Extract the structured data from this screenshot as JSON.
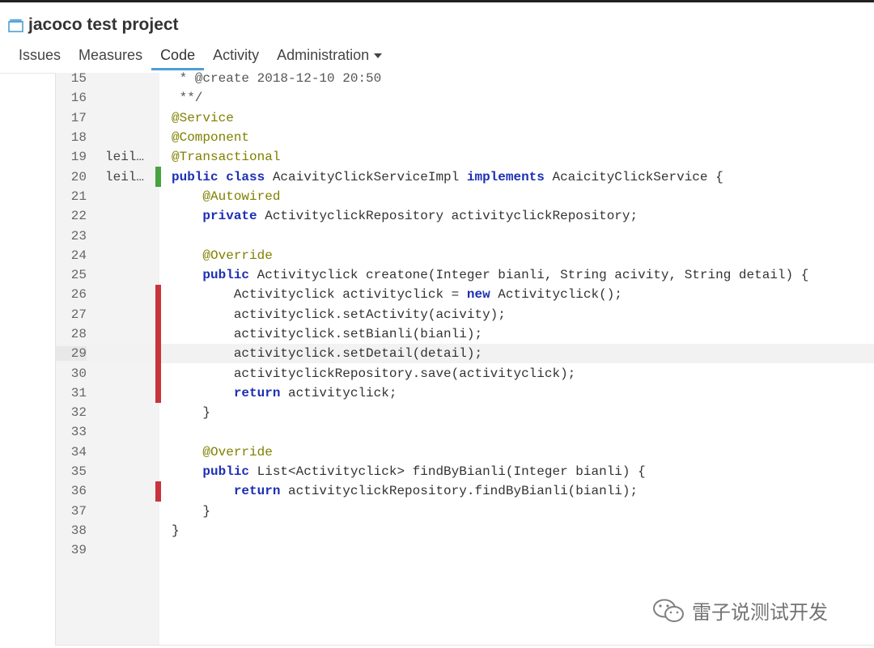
{
  "project": {
    "title": "jacoco test project",
    "icon": "project-icon"
  },
  "tabs": [
    {
      "label": "Issues",
      "active": false
    },
    {
      "label": "Measures",
      "active": false
    },
    {
      "label": "Code",
      "active": true
    },
    {
      "label": "Activity",
      "active": false
    },
    {
      "label": "Administration",
      "active": false,
      "dropdown": true
    }
  ],
  "colors": {
    "covered": "#48a23f",
    "uncovered": "#c8343e",
    "keyword": "#1c2fb5",
    "annotation": "#808000",
    "active_tab": "#4b9fd5"
  },
  "source": {
    "lines": [
      {
        "num": "15",
        "scm": "",
        "cov": "",
        "tokens": [
          {
            "t": "cm",
            "v": " * @create 2018-12-10 20:50"
          }
        ]
      },
      {
        "num": "16",
        "scm": "",
        "cov": "",
        "tokens": [
          {
            "t": "cm",
            "v": " **/"
          }
        ]
      },
      {
        "num": "17",
        "scm": "",
        "cov": "",
        "tokens": [
          {
            "t": "an",
            "v": "@Service"
          }
        ]
      },
      {
        "num": "18",
        "scm": "",
        "cov": "",
        "tokens": [
          {
            "t": "an",
            "v": "@Component"
          }
        ]
      },
      {
        "num": "19",
        "scm": "leil…",
        "cov": "",
        "tokens": [
          {
            "t": "an",
            "v": "@Transactional"
          }
        ]
      },
      {
        "num": "20",
        "scm": "leil…",
        "cov": "covered",
        "tokens": [
          {
            "t": "kw",
            "v": "public class"
          },
          {
            "t": "p",
            "v": " AcaivityClickServiceImpl "
          },
          {
            "t": "kw",
            "v": "implements"
          },
          {
            "t": "p",
            "v": " AcaicityClickService {"
          }
        ]
      },
      {
        "num": "21",
        "scm": "",
        "cov": "",
        "tokens": [
          {
            "t": "p",
            "v": "    "
          },
          {
            "t": "an",
            "v": "@Autowired"
          }
        ]
      },
      {
        "num": "22",
        "scm": "",
        "cov": "",
        "tokens": [
          {
            "t": "p",
            "v": "    "
          },
          {
            "t": "kw",
            "v": "private"
          },
          {
            "t": "p",
            "v": " ActivityclickRepository activityclickRepository;"
          }
        ]
      },
      {
        "num": "23",
        "scm": "",
        "cov": "",
        "tokens": [
          {
            "t": "p",
            "v": ""
          }
        ]
      },
      {
        "num": "24",
        "scm": "",
        "cov": "",
        "tokens": [
          {
            "t": "p",
            "v": "    "
          },
          {
            "t": "an",
            "v": "@Override"
          }
        ]
      },
      {
        "num": "25",
        "scm": "",
        "cov": "",
        "tokens": [
          {
            "t": "p",
            "v": "    "
          },
          {
            "t": "kw",
            "v": "public"
          },
          {
            "t": "p",
            "v": " Activityclick creatone(Integer bianli, String acivity, String detail) {"
          }
        ]
      },
      {
        "num": "26",
        "scm": "",
        "cov": "uncovered",
        "tokens": [
          {
            "t": "p",
            "v": "        Activityclick activityclick = "
          },
          {
            "t": "kw",
            "v": "new"
          },
          {
            "t": "p",
            "v": " Activityclick();"
          }
        ]
      },
      {
        "num": "27",
        "scm": "",
        "cov": "uncovered",
        "tokens": [
          {
            "t": "p",
            "v": "        activityclick.setActivity(acivity);"
          }
        ]
      },
      {
        "num": "28",
        "scm": "",
        "cov": "uncovered",
        "tokens": [
          {
            "t": "p",
            "v": "        activityclick.setBianli(bianli);"
          }
        ]
      },
      {
        "num": "29",
        "scm": "",
        "cov": "uncovered",
        "highlight": true,
        "tokens": [
          {
            "t": "p",
            "v": "        activityclick.setDetail(detail);"
          }
        ]
      },
      {
        "num": "30",
        "scm": "",
        "cov": "uncovered",
        "tokens": [
          {
            "t": "p",
            "v": "        activityclickRepository.save(activityclick);"
          }
        ]
      },
      {
        "num": "31",
        "scm": "",
        "cov": "uncovered",
        "tokens": [
          {
            "t": "p",
            "v": "        "
          },
          {
            "t": "kw",
            "v": "return"
          },
          {
            "t": "p",
            "v": " activityclick;"
          }
        ]
      },
      {
        "num": "32",
        "scm": "",
        "cov": "",
        "tokens": [
          {
            "t": "p",
            "v": "    }"
          }
        ]
      },
      {
        "num": "33",
        "scm": "",
        "cov": "",
        "tokens": [
          {
            "t": "p",
            "v": ""
          }
        ]
      },
      {
        "num": "34",
        "scm": "",
        "cov": "",
        "tokens": [
          {
            "t": "p",
            "v": "    "
          },
          {
            "t": "an",
            "v": "@Override"
          }
        ]
      },
      {
        "num": "35",
        "scm": "",
        "cov": "",
        "tokens": [
          {
            "t": "p",
            "v": "    "
          },
          {
            "t": "kw",
            "v": "public"
          },
          {
            "t": "p",
            "v": " List<Activityclick> findByBianli(Integer bianli) {"
          }
        ]
      },
      {
        "num": "36",
        "scm": "",
        "cov": "uncovered",
        "tokens": [
          {
            "t": "p",
            "v": "        "
          },
          {
            "t": "kw",
            "v": "return"
          },
          {
            "t": "p",
            "v": " activityclickRepository.findByBianli(bianli);"
          }
        ]
      },
      {
        "num": "37",
        "scm": "",
        "cov": "",
        "tokens": [
          {
            "t": "p",
            "v": "    }"
          }
        ]
      },
      {
        "num": "38",
        "scm": "",
        "cov": "",
        "tokens": [
          {
            "t": "p",
            "v": "}"
          }
        ]
      },
      {
        "num": "39",
        "scm": "",
        "cov": "",
        "tokens": [
          {
            "t": "p",
            "v": ""
          }
        ]
      }
    ]
  },
  "watermark": {
    "text": "雷子说测试开发",
    "icon": "wechat-icon"
  }
}
